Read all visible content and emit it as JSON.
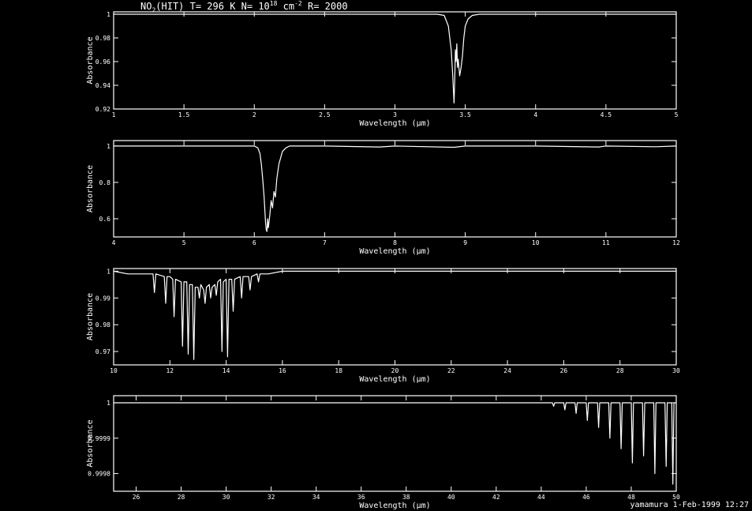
{
  "title": {
    "species": "NO",
    "species_sub": "2",
    "rest1": "(HIT) T= 296 K N= 10",
    "exp": "18",
    "rest2": " cm",
    "cm_exp": "-2",
    "rest3": " R= 2000"
  },
  "footer": "yamamura  1-Feb-1999 12:27",
  "chart_data": [
    {
      "type": "line",
      "xlabel": "Wavelength (μm)",
      "ylabel": "Absorbance",
      "xlim": [
        1,
        5
      ],
      "ylim": [
        0.92,
        1.002
      ],
      "xticks": [
        1,
        1.5,
        2,
        2.5,
        3,
        3.5,
        4,
        4.5,
        5
      ],
      "xtick_labels": [
        "1",
        "1.5",
        "2",
        "2.5",
        "3",
        "3.5",
        "4",
        "4.5",
        "5"
      ],
      "yticks": [
        0.92,
        0.94,
        0.96,
        0.98,
        1
      ],
      "ytick_labels": [
        "0.92",
        "0.94",
        "0.96",
        "0.98",
        "1"
      ],
      "series": [
        {
          "x": [
            1.0,
            3.0,
            3.3,
            3.35,
            3.38,
            3.4,
            3.41,
            3.42,
            3.425,
            3.43,
            3.435,
            3.44,
            3.445,
            3.45,
            3.46,
            3.47,
            3.48,
            3.49,
            3.5,
            3.52,
            3.55,
            3.6,
            4.0,
            5.0
          ],
          "y": [
            1.0,
            1.0,
            1.0,
            0.999,
            0.99,
            0.97,
            0.95,
            0.925,
            0.945,
            0.97,
            0.96,
            0.975,
            0.955,
            0.962,
            0.948,
            0.955,
            0.965,
            0.98,
            0.99,
            0.996,
            0.999,
            1.0,
            1.0,
            1.0
          ]
        }
      ]
    },
    {
      "type": "line",
      "xlabel": "Wavelength (μm)",
      "ylabel": "Absorbance",
      "xlim": [
        4,
        12
      ],
      "ylim": [
        0.5,
        1.03
      ],
      "xticks": [
        4,
        5,
        6,
        7,
        8,
        9,
        10,
        11,
        12
      ],
      "xtick_labels": [
        "4",
        "5",
        "6",
        "7",
        "8",
        "9",
        "10",
        "11",
        "12"
      ],
      "yticks": [
        0.6,
        0.8,
        1
      ],
      "ytick_labels": [
        "0.6",
        "0.8",
        "1"
      ],
      "series": [
        {
          "x": [
            4.0,
            5.5,
            6.0,
            6.05,
            6.08,
            6.1,
            6.12,
            6.14,
            6.15,
            6.16,
            6.17,
            6.18,
            6.19,
            6.2,
            6.22,
            6.24,
            6.26,
            6.28,
            6.3,
            6.32,
            6.35,
            6.4,
            6.45,
            6.5,
            7.0,
            7.78,
            8.0,
            8.84,
            9.0,
            10.0,
            10.9,
            11.0,
            11.7,
            12.0
          ],
          "y": [
            1.0,
            1.0,
            1.0,
            0.99,
            0.96,
            0.9,
            0.82,
            0.72,
            0.65,
            0.58,
            0.54,
            0.53,
            0.6,
            0.55,
            0.62,
            0.7,
            0.66,
            0.75,
            0.72,
            0.82,
            0.9,
            0.97,
            0.99,
            1.0,
            1.0,
            0.995,
            1.0,
            0.993,
            1.0,
            1.0,
            0.995,
            1.0,
            0.996,
            1.0
          ]
        }
      ]
    },
    {
      "type": "line",
      "xlabel": "Wavelength (μm)",
      "ylabel": "Absorbance",
      "xlim": [
        10,
        30
      ],
      "ylim": [
        0.965,
        1.001
      ],
      "xticks": [
        10,
        12,
        14,
        16,
        18,
        20,
        22,
        24,
        26,
        28,
        30
      ],
      "xtick_labels": [
        "10",
        "12",
        "14",
        "16",
        "18",
        "20",
        "22",
        "24",
        "26",
        "28",
        "30"
      ],
      "yticks": [
        0.97,
        0.98,
        0.99,
        1
      ],
      "ytick_labels": [
        "0.97",
        "0.98",
        "0.99",
        "1"
      ],
      "series": [
        {
          "x": [
            10.0,
            10.5,
            11.0,
            11.4,
            11.45,
            11.5,
            11.8,
            11.85,
            11.9,
            12.0,
            12.1,
            12.15,
            12.2,
            12.4,
            12.45,
            12.5,
            12.6,
            12.65,
            12.7,
            12.8,
            12.85,
            12.9,
            13.0,
            13.05,
            13.1,
            13.2,
            13.25,
            13.3,
            13.4,
            13.45,
            13.5,
            13.6,
            13.65,
            13.7,
            13.8,
            13.85,
            13.9,
            14.0,
            14.05,
            14.1,
            14.2,
            14.25,
            14.3,
            14.5,
            14.55,
            14.6,
            14.8,
            14.85,
            14.9,
            15.1,
            15.15,
            15.2,
            15.5,
            16.0,
            16.5,
            30.0
          ],
          "y": [
            1.0,
            0.999,
            0.999,
            0.999,
            0.992,
            0.999,
            0.998,
            0.988,
            0.998,
            0.998,
            0.997,
            0.983,
            0.997,
            0.996,
            0.972,
            0.996,
            0.996,
            0.969,
            0.995,
            0.995,
            0.967,
            0.994,
            0.994,
            0.99,
            0.995,
            0.993,
            0.988,
            0.994,
            0.995,
            0.99,
            0.994,
            0.995,
            0.991,
            0.996,
            0.997,
            0.97,
            0.996,
            0.997,
            0.968,
            0.997,
            0.997,
            0.985,
            0.997,
            0.998,
            0.99,
            0.998,
            0.998,
            0.993,
            0.998,
            0.999,
            0.996,
            0.999,
            0.999,
            1.0,
            1.0,
            1.0
          ]
        }
      ]
    },
    {
      "type": "line",
      "xlabel": "Wavelength (μm)",
      "ylabel": "Absorbance",
      "xlim": [
        25,
        50
      ],
      "ylim": [
        0.99975,
        1.00002
      ],
      "xticks": [
        26,
        28,
        30,
        32,
        34,
        36,
        38,
        40,
        42,
        44,
        46,
        48,
        50
      ],
      "xtick_labels": [
        "26",
        "28",
        "30",
        "32",
        "34",
        "36",
        "38",
        "40",
        "42",
        "44",
        "46",
        "48",
        "50"
      ],
      "yticks": [
        0.9998,
        0.9999,
        1
      ],
      "ytick_labels": [
        "0.9998",
        "0.9999",
        "1"
      ],
      "series": [
        {
          "x": [
            25.0,
            44.5,
            44.55,
            44.6,
            45.0,
            45.05,
            45.1,
            45.5,
            45.55,
            45.6,
            46.0,
            46.05,
            46.1,
            46.5,
            46.55,
            46.6,
            47.0,
            47.05,
            47.1,
            47.5,
            47.55,
            47.6,
            48.0,
            48.05,
            48.1,
            48.5,
            48.55,
            48.6,
            49.0,
            49.05,
            49.1,
            49.5,
            49.55,
            49.6,
            49.8,
            49.85,
            49.9,
            50.0
          ],
          "y": [
            1.0,
            1.0,
            0.99999,
            1.0,
            1.0,
            0.99998,
            1.0,
            1.0,
            0.99997,
            1.0,
            1.0,
            0.99995,
            1.0,
            1.0,
            0.99993,
            1.0,
            1.0,
            0.9999,
            1.0,
            1.0,
            0.99987,
            1.0,
            1.0,
            0.99983,
            1.0,
            1.0,
            0.99985,
            1.0,
            1.0,
            0.9998,
            1.0,
            1.0,
            0.99982,
            1.0,
            1.0,
            0.99977,
            1.0,
            1.0
          ]
        }
      ]
    }
  ]
}
